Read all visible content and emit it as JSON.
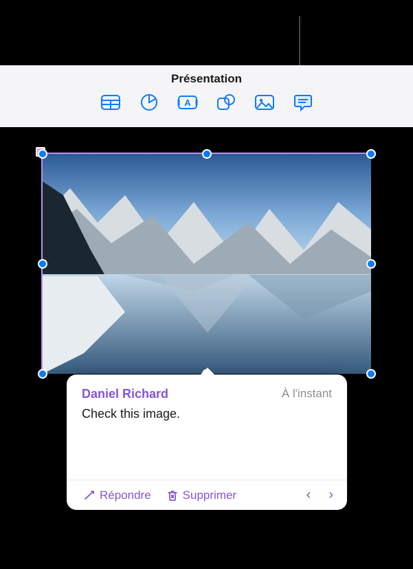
{
  "header": {
    "title": "Présentation"
  },
  "toolbar": {
    "icons": [
      "table-icon",
      "chart-icon",
      "text-icon",
      "shape-icon",
      "media-icon",
      "comment-icon"
    ],
    "colors": {
      "stroke": "#0a7bff"
    }
  },
  "comment": {
    "author": "Daniel Richard",
    "timestamp": "À l'instant",
    "body": "Check this image.",
    "actions": {
      "reply": "Répondre",
      "delete": "Supprimer",
      "prev": "‹",
      "next": "›"
    }
  },
  "selection": {
    "handle_color": "#0a7bff",
    "border_color": "#b991f0"
  }
}
